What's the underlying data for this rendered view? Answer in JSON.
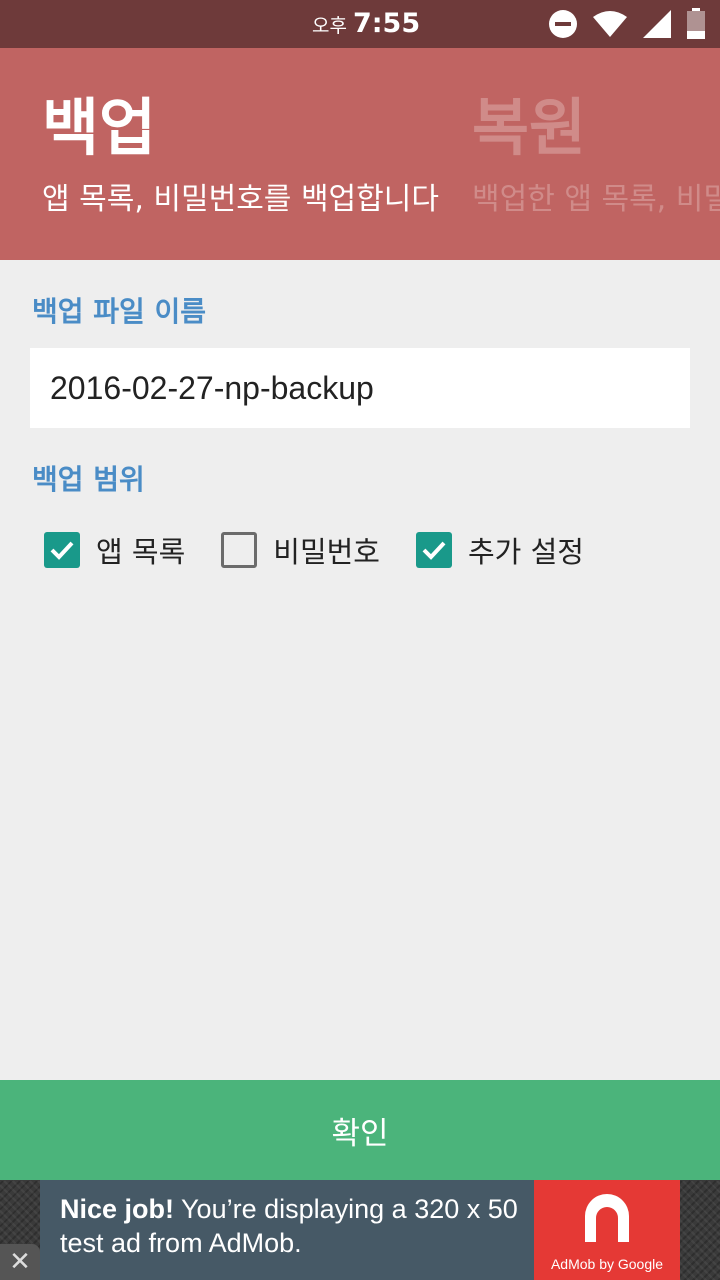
{
  "status_bar": {
    "ampm": "오후",
    "time": "7:55",
    "icons": [
      "do-not-disturb-icon",
      "wifi-icon",
      "signal-icon",
      "battery-icon"
    ]
  },
  "header": {
    "tabs": [
      {
        "title": "백업",
        "subtitle": "앱 목록, 비밀번호를 백업합니다",
        "active": true
      },
      {
        "title": "복원",
        "subtitle": "백업한 앱 목록, 비밀",
        "active": false
      }
    ],
    "color": "#c06462"
  },
  "form": {
    "filename_label": "백업 파일 이름",
    "filename_value": "2016-02-27-np-backup",
    "range_label": "백업 범위",
    "options": [
      {
        "label": "앱 목록",
        "checked": true
      },
      {
        "label": "비밀번호",
        "checked": false
      },
      {
        "label": "추가 설정",
        "checked": true
      }
    ]
  },
  "confirm_button": {
    "label": "확인",
    "color": "#4bb47b"
  },
  "ad": {
    "headline": "Nice job!",
    "body": "You’re displaying a 320 x 50 test ad from AdMob.",
    "logo_caption": "AdMob by Google",
    "close_glyph": "✕"
  }
}
